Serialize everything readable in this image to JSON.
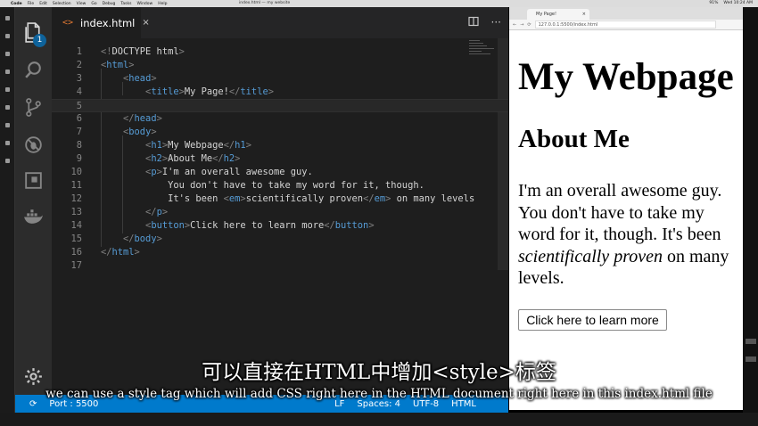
{
  "menubar": {
    "app": "Code",
    "menus": [
      "Code",
      "File",
      "Edit",
      "Selection",
      "View",
      "Go",
      "Debug",
      "Tasks",
      "Window",
      "Help"
    ],
    "window_title": "index.html — my website",
    "battery": "91%",
    "clock": "Wed 10:24 AM"
  },
  "vscode": {
    "explorer_badge": "1",
    "tab": {
      "icon": "<>",
      "label": "index.html",
      "close": "×"
    },
    "code_lines": [
      {
        "num": "1",
        "html": "<span class='p'>&lt;!</span><span>DOCTYPE html</span><span class='p'>&gt;</span>"
      },
      {
        "num": "2",
        "html": "<span class='p'>&lt;</span><span class='t'>html</span><span class='p'>&gt;</span>"
      },
      {
        "num": "3",
        "html": "    <span class='p'>&lt;</span><span class='t'>head</span><span class='p'>&gt;</span>"
      },
      {
        "num": "4",
        "html": "        <span class='p'>&lt;</span><span class='t'>title</span><span class='p'>&gt;</span>My Page!<span class='p'>&lt;/</span><span class='t'>title</span><span class='p'>&gt;</span>"
      },
      {
        "num": "5",
        "html": ""
      },
      {
        "num": "6",
        "html": "    <span class='p'>&lt;/</span><span class='t'>head</span><span class='p'>&gt;</span>"
      },
      {
        "num": "7",
        "html": "    <span class='p'>&lt;</span><span class='t'>body</span><span class='p'>&gt;</span>"
      },
      {
        "num": "8",
        "html": "        <span class='p'>&lt;</span><span class='t'>h1</span><span class='p'>&gt;</span>My Webpage<span class='p'>&lt;/</span><span class='t'>h1</span><span class='p'>&gt;</span>"
      },
      {
        "num": "9",
        "html": "        <span class='p'>&lt;</span><span class='t'>h2</span><span class='p'>&gt;</span>About Me<span class='p'>&lt;/</span><span class='t'>h2</span><span class='p'>&gt;</span>"
      },
      {
        "num": "10",
        "html": "        <span class='p'>&lt;</span><span class='t'>p</span><span class='p'>&gt;</span>I'm an overall awesome guy."
      },
      {
        "num": "11",
        "html": "            You don't have to take my word for it, though."
      },
      {
        "num": "12",
        "html": "            It's been <span class='p'>&lt;</span><span class='t'>em</span><span class='p'>&gt;</span>scientifically proven<span class='p'>&lt;/</span><span class='t'>em</span><span class='p'>&gt;</span> on many levels"
      },
      {
        "num": "13",
        "html": "        <span class='p'>&lt;/</span><span class='t'>p</span><span class='p'>&gt;</span>"
      },
      {
        "num": "14",
        "html": "        <span class='p'>&lt;</span><span class='t'>button</span><span class='p'>&gt;</span>Click here to learn more<span class='p'>&lt;/</span><span class='t'>button</span><span class='p'>&gt;</span>"
      },
      {
        "num": "15",
        "html": "    <span class='p'>&lt;/</span><span class='t'>body</span><span class='p'>&gt;</span>"
      },
      {
        "num": "16",
        "html": "<span class='p'>&lt;/</span><span class='t'>html</span><span class='p'>&gt;</span>"
      },
      {
        "num": "17",
        "html": ""
      }
    ],
    "status": {
      "port": "Port : 5500",
      "eol": "LF",
      "encoding": "UTF-8",
      "spaces": "Spaces: 4",
      "language": "HTML"
    }
  },
  "browser": {
    "tab_title": "My Page!",
    "url": "127.0.0.1:5500/index.html",
    "h1": "My Webpage",
    "h2": "About Me",
    "p_text": "I'm an overall awesome guy. You don't have to take my word for it, though. It's been ",
    "p_em": "scientifically proven",
    "p_tail": " on many levels.",
    "button": "Click here to learn more"
  },
  "subtitles": {
    "chinese": "可以直接在HTML中增加<style>标签",
    "english": "we can use a style tag which will add CSS right here in the HTML document right here in this index.html file"
  },
  "colors": {
    "statusbar": "#007acc",
    "editor_bg": "#1e1e1e",
    "tag": "#569cd6",
    "punct": "#808080"
  }
}
